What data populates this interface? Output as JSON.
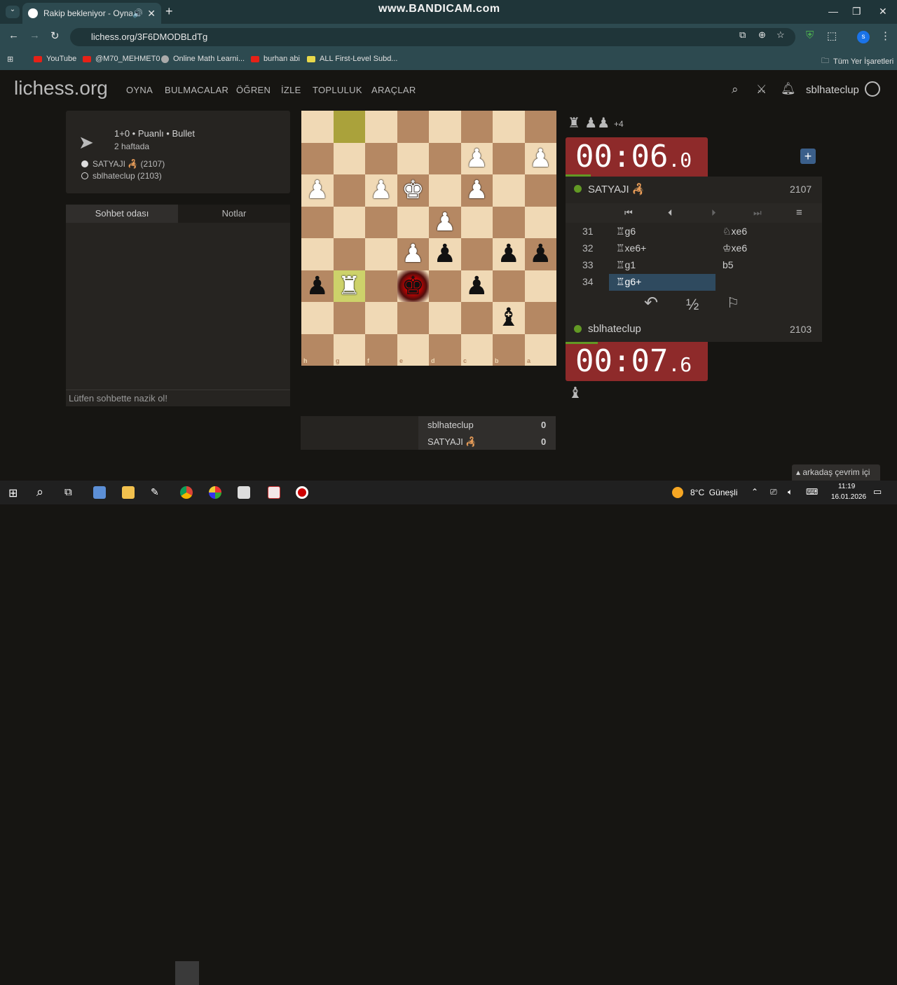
{
  "browser": {
    "tab_title": "Rakip bekleniyor - Oyna SA",
    "watermark": "www.BANDICAM.com",
    "url": "lichess.org/3F6DMODBLdTg",
    "bookmarks": [
      "YouTube",
      "@M70_MEHMET0",
      "Online Math Learni...",
      "burhan abi",
      "ALL First-Level Subd...",
      "Tüm Yer İşaretleri"
    ]
  },
  "site": {
    "logo": "lichess.org",
    "nav": [
      "OYNA",
      "BULMACALAR",
      "ÖĞREN",
      "İZLE",
      "TOPLULUK",
      "ARAÇLAR"
    ],
    "username": "sblhateclup"
  },
  "game_info": {
    "mode": "1+0 • Puanlı • Bullet",
    "when": "2 haftada",
    "white_player": "SATYAJI 🦂 (2107)",
    "black_player": "sblhateclup (2103)"
  },
  "chat": {
    "tab_chat": "Sohbet odası",
    "tab_notes": "Notlar",
    "placeholder": "Lütfen sohbette nazik ol!"
  },
  "board": {
    "ranks": [
      "1",
      "2",
      "3",
      "4",
      "5",
      "6",
      "7",
      "8"
    ],
    "files": [
      "h",
      "g",
      "f",
      "e",
      "d",
      "c",
      "b",
      "a"
    ]
  },
  "top_player": {
    "captured": "♜ ♟♟",
    "material": "+4",
    "clock_main": "00:06",
    "clock_tenths": ".0",
    "name": "SATYAJI 🦂",
    "rating": "2107"
  },
  "bottom_player": {
    "name": "sblhateclup",
    "rating": "2103",
    "clock_main": "00:07",
    "clock_tenths": ".6"
  },
  "moves": [
    {
      "num": "31",
      "white": "♖g6",
      "black": "♘xe6"
    },
    {
      "num": "32",
      "white": "♖xe6+",
      "black": "♔xe6"
    },
    {
      "num": "33",
      "white": "♖g1",
      "black": "b5"
    },
    {
      "num": "34",
      "white": "♖g6+",
      "black": ""
    }
  ],
  "actions": {
    "takeback": "↶",
    "draw": "½",
    "resign": "⚐"
  },
  "scoreboard": [
    {
      "name": "sblhateclup",
      "score": "0"
    },
    {
      "name": "SATYAJI 🦂",
      "score": "0"
    }
  ],
  "friends": "arkadaş çevrim içi",
  "taskbar": {
    "weather": "8°C  Güneşli",
    "time": "11:19",
    "date": "16.01.2026"
  },
  "colors": {
    "accent": "#8e2a2a",
    "online": "#629924",
    "bg": "#161512"
  }
}
